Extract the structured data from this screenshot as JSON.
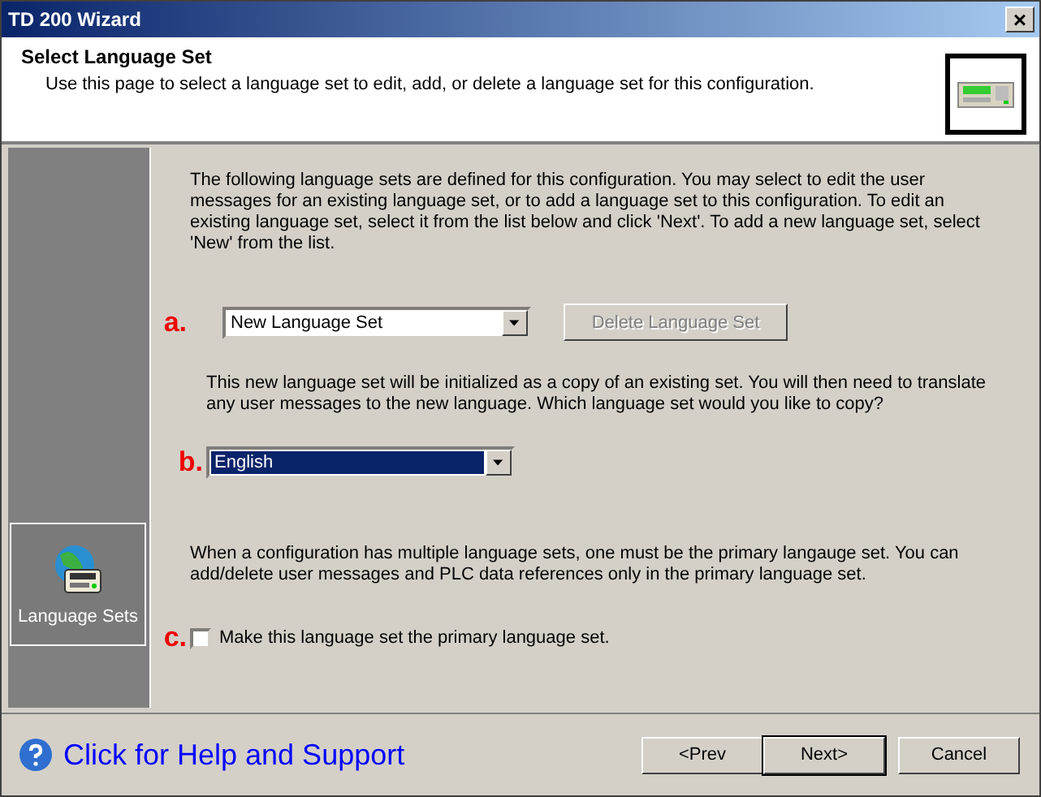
{
  "window": {
    "title": "TD 200 Wizard",
    "close": "×"
  },
  "header": {
    "title": "Select Language Set",
    "subtitle": "Use this page to select a language set to edit, add, or delete a language set for this configuration."
  },
  "sidebar": {
    "items": [
      {
        "label": "Language Sets",
        "selected": true
      }
    ]
  },
  "intro": "The following language sets are defined for this configuration. You may select to edit the user messages for an existing language set, or to add a language set to this configuration. To edit an existing language set, select it from the list below and click 'Next'. To add a new language set, select 'New' from the list.",
  "language_set": {
    "marker": "a.",
    "value": "New Language Set",
    "focused": false
  },
  "delete_button": {
    "label": "Delete Language Set",
    "disabled": true
  },
  "copy_text": "This new language set will be initialized as a copy of an existing set. You will then need to translate any user messages to the new language. Which language set would you like to copy?",
  "copy_set": {
    "marker": "b.",
    "value": "English",
    "focused": true
  },
  "primary_text": "When a configuration has multiple language sets, one must be the primary langauge set. You can add/delete user messages and PLC data references only in the primary language set.",
  "primary_checkbox": {
    "marker": "c.",
    "label": "Make this language set the primary language set.",
    "checked": false
  },
  "help_link": "Click for Help and Support",
  "buttons": [
    {
      "label": "<Prev",
      "default": false
    },
    {
      "label": "Next>",
      "default": true
    },
    {
      "label": "Cancel",
      "default": false
    }
  ]
}
